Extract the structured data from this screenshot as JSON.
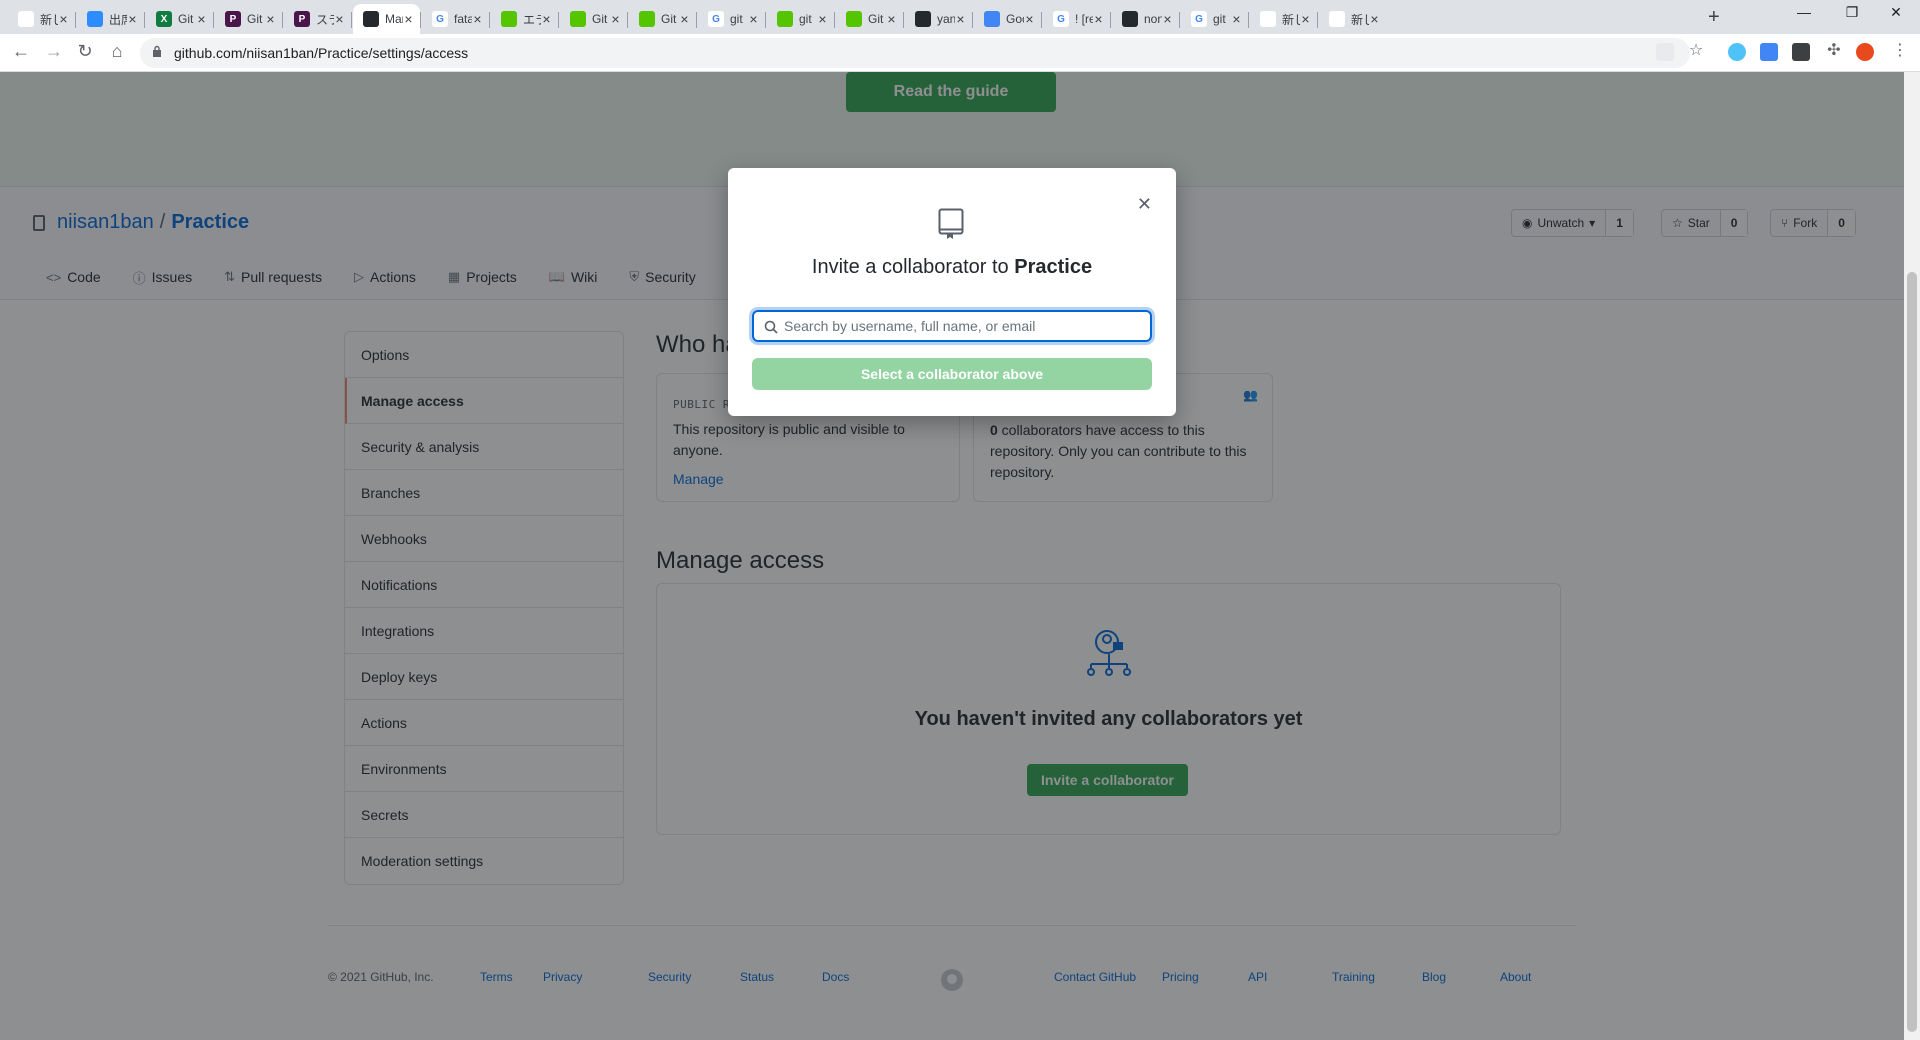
{
  "browser": {
    "tabs": [
      {
        "title": "新しいタブ",
        "fav_color": "#ffffff",
        "fav_char": ""
      },
      {
        "title": "出席",
        "fav_color": "#2d8cff",
        "fav_char": ""
      },
      {
        "title": "Git",
        "fav_color": "#107c41",
        "fav_char": "X"
      },
      {
        "title": "Git",
        "fav_color": "#4a154b",
        "fav_char": "P"
      },
      {
        "title": "スラ",
        "fav_color": "#4a154b",
        "fav_char": "P"
      },
      {
        "title": "Mar",
        "fav_color": "#24292e",
        "fav_char": ""
      },
      {
        "title": "fata",
        "fav_color": "#ffffff",
        "fav_char": "G"
      },
      {
        "title": "エラ",
        "fav_color": "#55c500",
        "fav_char": ""
      },
      {
        "title": "Git",
        "fav_color": "#55c500",
        "fav_char": ""
      },
      {
        "title": "Git",
        "fav_color": "#55c500",
        "fav_char": ""
      },
      {
        "title": "git",
        "fav_color": "#ffffff",
        "fav_char": "G"
      },
      {
        "title": "git",
        "fav_color": "#55c500",
        "fav_char": ""
      },
      {
        "title": "Git",
        "fav_color": "#55c500",
        "fav_char": ""
      },
      {
        "title": "yan",
        "fav_color": "#24292e",
        "fav_char": ""
      },
      {
        "title": "Goo",
        "fav_color": "#4285f4",
        "fav_char": ""
      },
      {
        "title": "! [re",
        "fav_color": "#ffffff",
        "fav_char": "G"
      },
      {
        "title": "non",
        "fav_color": "#24292e",
        "fav_char": ""
      },
      {
        "title": "git",
        "fav_color": "#ffffff",
        "fav_char": "G"
      },
      {
        "title": "新しいタ",
        "fav_color": "#ffffff",
        "fav_char": ""
      },
      {
        "title": "新しいタ",
        "fav_color": "#ffffff",
        "fav_char": ""
      }
    ],
    "active_tab_index": 5,
    "url": "github.com/niisan1ban/Practice/settings/access"
  },
  "banner": {
    "guide_button": "Read the guide"
  },
  "repo": {
    "owner": "niisan1ban",
    "separator": "/",
    "name": "Practice",
    "watch_label": "Unwatch",
    "watch_count": "1",
    "star_label": "Star",
    "star_count": "0",
    "fork_label": "Fork",
    "fork_count": "0",
    "nav": [
      {
        "label": "Code",
        "icon": "<>"
      },
      {
        "label": "Issues",
        "icon": "ⓘ"
      },
      {
        "label": "Pull requests",
        "icon": "⇅"
      },
      {
        "label": "Actions",
        "icon": "▷"
      },
      {
        "label": "Projects",
        "icon": "▦"
      },
      {
        "label": "Wiki",
        "icon": "📖"
      },
      {
        "label": "Security",
        "icon": "⛨"
      }
    ]
  },
  "sidebar": {
    "items": [
      "Options",
      "Manage access",
      "Security & analysis",
      "Branches",
      "Webhooks",
      "Notifications",
      "Integrations",
      "Deploy keys",
      "Actions",
      "Environments",
      "Secrets",
      "Moderation settings"
    ],
    "selected_index": 1
  },
  "main": {
    "who_heading": "Who has access",
    "public_card": {
      "label": "PUBLIC REPOSITORY",
      "text": "This repository is public and visible to anyone.",
      "link": "Manage"
    },
    "collab_card": {
      "count": "0",
      "text": " collaborators have access to this repository. Only you can contribute to this repository."
    },
    "manage_heading": "Manage access",
    "empty_title": "You haven't invited any collaborators yet",
    "invite_button": "Invite a collaborator"
  },
  "footer": {
    "copyright": "© 2021 GitHub, Inc.",
    "left_links": [
      "Terms",
      "Privacy",
      "Security",
      "Status",
      "Docs"
    ],
    "right_links": [
      "Contact GitHub",
      "Pricing",
      "API",
      "Training",
      "Blog",
      "About"
    ]
  },
  "modal": {
    "title_prefix": "Invite a collaborator to ",
    "title_repo": "Practice",
    "search_placeholder": "Search by username, full name, or email",
    "submit_label": "Select a collaborator above",
    "close_icon": "✕"
  },
  "colors": {
    "accent_green": "#2ea44f",
    "disabled_green": "#94d3a2",
    "link_blue": "#0366d6",
    "selected_marker": "#f9826c"
  }
}
